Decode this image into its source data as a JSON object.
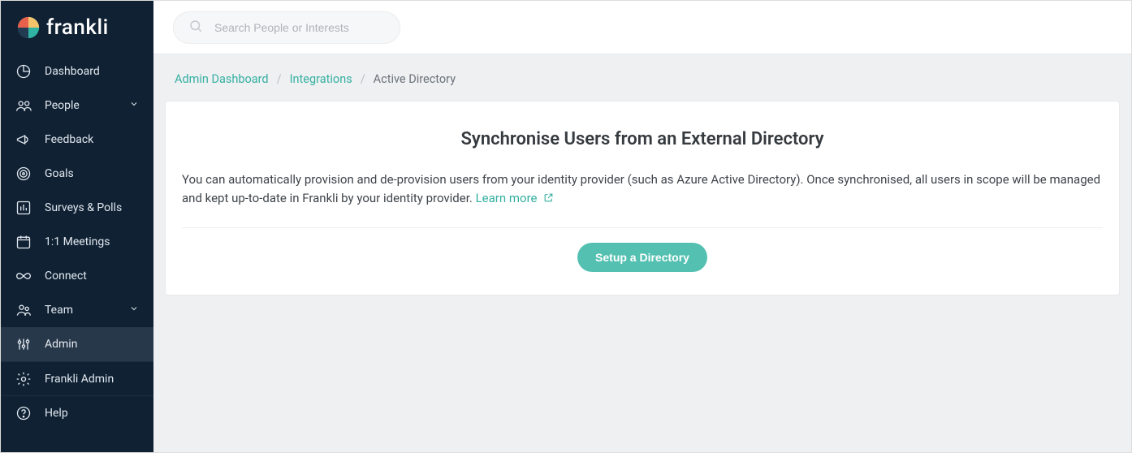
{
  "brand": {
    "name": "frankli"
  },
  "search": {
    "placeholder": "Search People or Interests"
  },
  "sidebar": {
    "items": [
      {
        "label": "Dashboard",
        "icon": "pie",
        "expandable": false
      },
      {
        "label": "People",
        "icon": "people",
        "expandable": true
      },
      {
        "label": "Feedback",
        "icon": "megaphone",
        "expandable": false
      },
      {
        "label": "Goals",
        "icon": "target",
        "expandable": false
      },
      {
        "label": "Surveys & Polls",
        "icon": "bar",
        "expandable": false
      },
      {
        "label": "1:1 Meetings",
        "icon": "calendar",
        "expandable": false
      },
      {
        "label": "Connect",
        "icon": "infinity",
        "expandable": false
      },
      {
        "label": "Team",
        "icon": "team",
        "expandable": true
      },
      {
        "label": "Admin",
        "icon": "sliders",
        "expandable": false,
        "active": true
      },
      {
        "label": "Frankli Admin",
        "icon": "gear",
        "expandable": false
      },
      {
        "label": "Help",
        "icon": "help",
        "expandable": false
      }
    ]
  },
  "breadcrumb": {
    "items": [
      {
        "label": "Admin Dashboard",
        "link": true
      },
      {
        "label": "Integrations",
        "link": true
      },
      {
        "label": "Active Directory",
        "link": false
      }
    ]
  },
  "page": {
    "heading": "Synchronise Users from an External Directory",
    "body": "You can automatically provision and de-provision users from your identity provider (such as Azure Active Directory). Once synchronised, all users in scope will be managed and kept up-to-date in Frankli by your identity provider. ",
    "learn_more": "Learn more",
    "cta": "Setup a Directory"
  }
}
